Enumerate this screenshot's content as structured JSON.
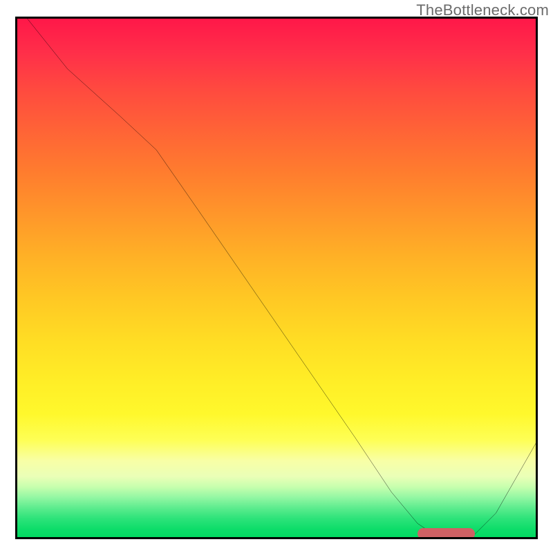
{
  "watermark_text": "TheBottleneck.com",
  "colors": {
    "frame_border": "#000000",
    "curve_stroke": "#000000",
    "pill": "#cf6164",
    "watermark": "#6b6b6b",
    "gradient_top": "#ff1649",
    "gradient_bottom": "#00d95f"
  },
  "chart_data": {
    "type": "line",
    "title": "",
    "xlabel": "",
    "ylabel": "",
    "xlim": [
      0,
      100
    ],
    "ylim": [
      0,
      100
    ],
    "grid": false,
    "legend": false,
    "series": [
      {
        "name": "bottleneck-curve",
        "x": [
          2,
          10,
          20,
          27,
          35,
          45,
          55,
          65,
          72,
          77,
          80,
          84.5,
          88,
          92,
          100
        ],
        "values": [
          100,
          90,
          81,
          74.5,
          63,
          48.5,
          34,
          19.5,
          9,
          3,
          1,
          0.5,
          1,
          5,
          19
        ]
      }
    ],
    "annotations": [
      {
        "name": "optimal-range-pill",
        "x_start": 77,
        "x_end": 88,
        "y": 0.5
      }
    ],
    "background": "heatmap-gradient-vertical"
  }
}
